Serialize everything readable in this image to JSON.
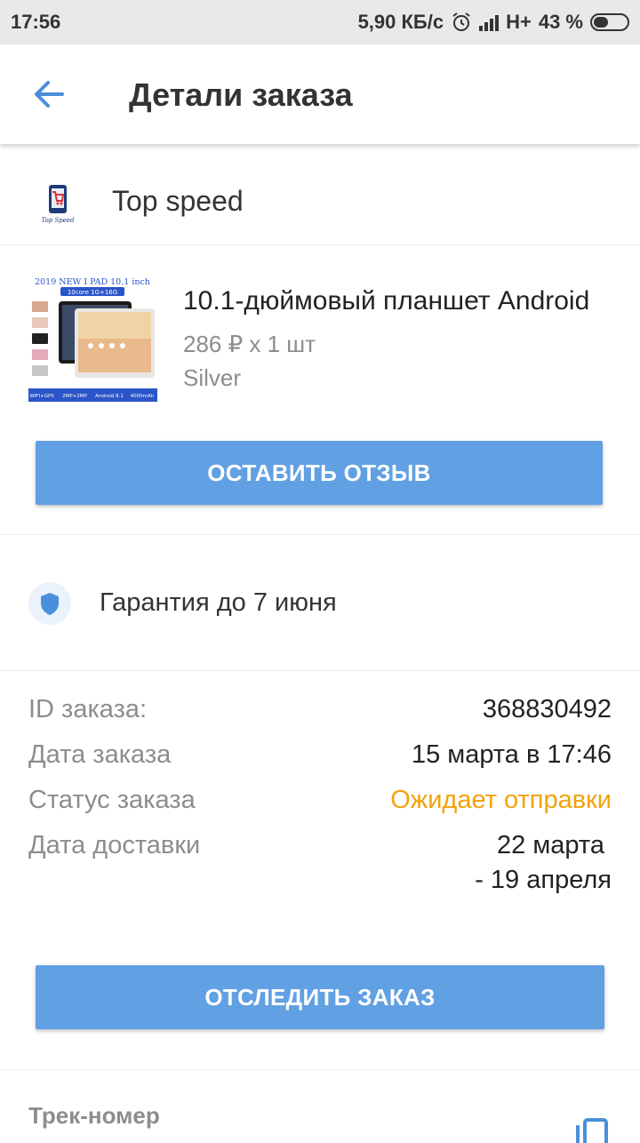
{
  "status_bar": {
    "time": "17:56",
    "network_speed": "5,90 КБ/с",
    "alarm_icon": "alarm-icon",
    "network_type": "H+",
    "battery": "43 %",
    "battery_level": 0.43
  },
  "header": {
    "back_icon": "arrow-left-icon",
    "title": "Детали заказа"
  },
  "store": {
    "logo_text": "Top Speed",
    "name": "Top speed"
  },
  "product": {
    "image_title": "2019 NEW I PAD 10.1 inch",
    "image_specs": "10core 1G+16G",
    "image_footer": [
      "WIFI+GPS",
      "2MP+2MP",
      "Android 8.1",
      "4000mAh"
    ],
    "title": "10.1-дюймовый планшет Android",
    "price": "286 ₽ x 1 шт",
    "variant": "Silver"
  },
  "review_button": "ОСТАВИТЬ ОТЗЫВ",
  "warranty": {
    "icon": "shield-icon",
    "text": "Гарантия до 7 июня"
  },
  "order_info": {
    "id_label": "ID заказа:",
    "id_value": "368830492",
    "date_label": "Дата заказа",
    "date_value": "15 марта в 17:46",
    "status_label": "Статус заказа",
    "status_value": "Ожидает отправки",
    "status_color": "#f2a20d",
    "delivery_label": "Дата доставки",
    "delivery_value_line1": "22 марта",
    "delivery_value_line2": "- 19 апреля"
  },
  "track_button": "ОТСЛЕДИТЬ ЗАКАЗ",
  "tracking": {
    "label": "Трек-номер",
    "copy_icon": "copy-icon"
  },
  "colors": {
    "accent": "#61a0e3",
    "status_pending": "#f2a20d"
  }
}
